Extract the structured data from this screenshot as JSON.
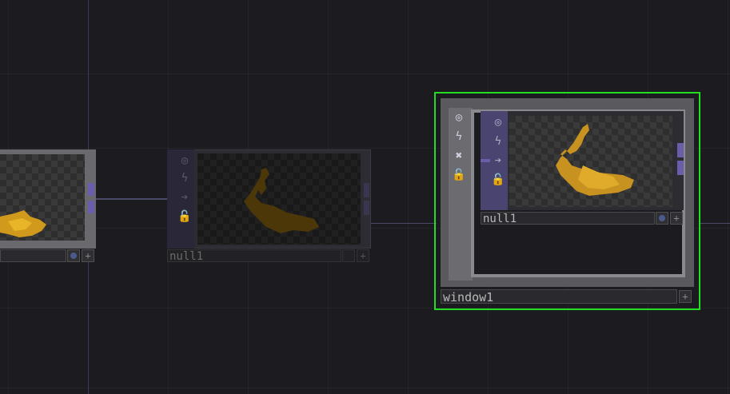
{
  "canvas": {
    "accent_selection": "#22dd22",
    "wire_color": "#4a4a68"
  },
  "nodes": {
    "left_node": {
      "name": ""
    },
    "null_node": {
      "name": "null1"
    },
    "window_node": {
      "name": "window1",
      "inner_null_name": "null1"
    }
  },
  "icons": {
    "viewer": "target-icon",
    "cook": "lightning-icon",
    "export": "arrow-icon",
    "lock": "lock-icon",
    "close": "close-icon",
    "add": "plus-icon"
  }
}
